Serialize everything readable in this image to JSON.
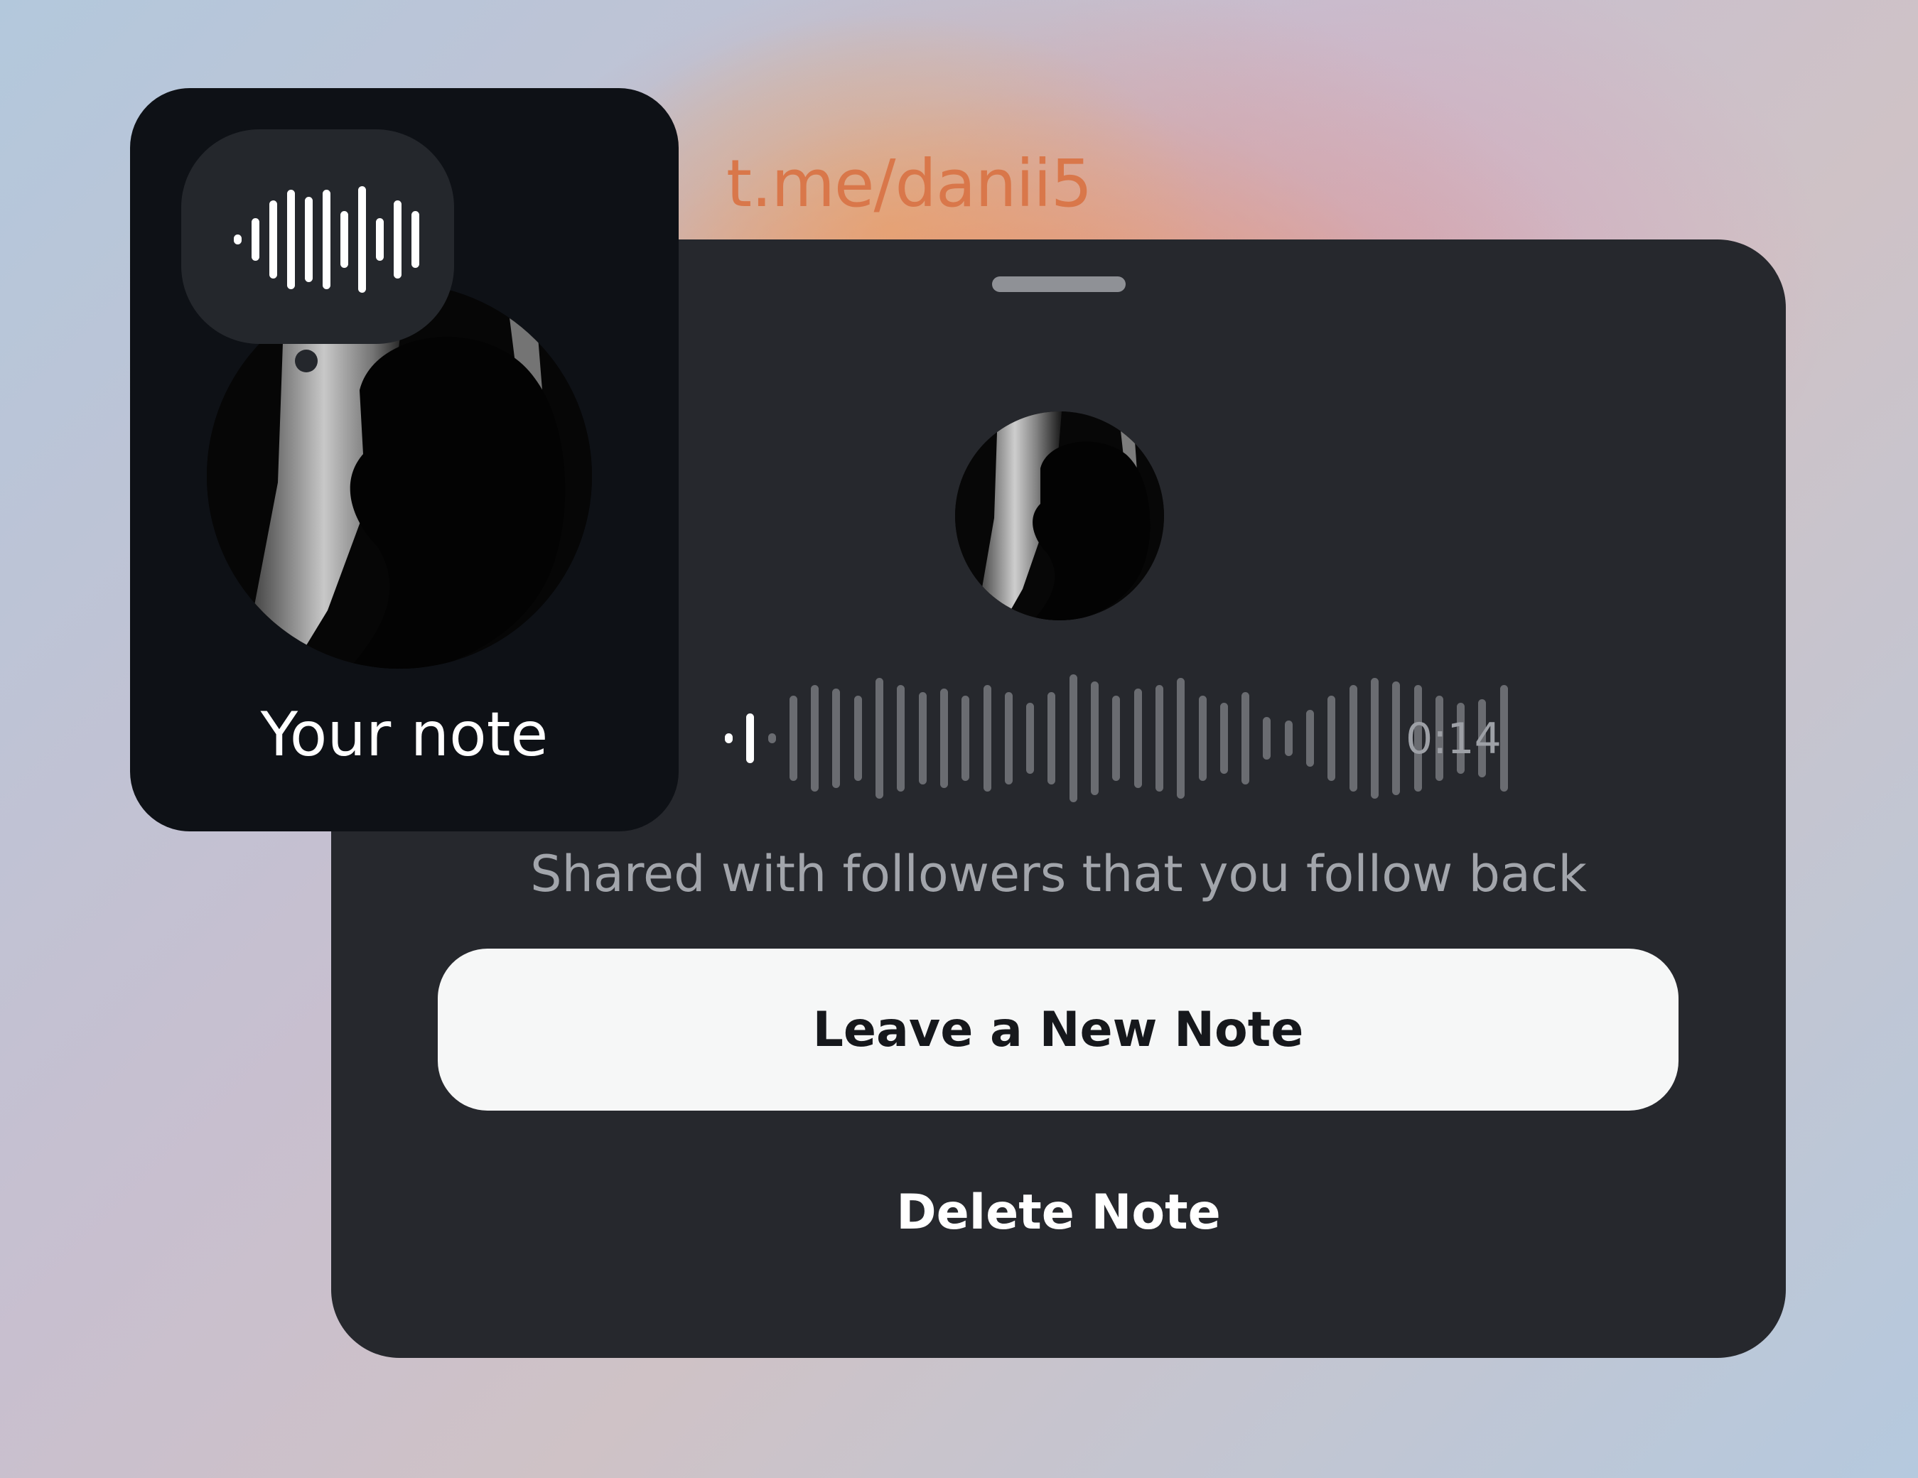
{
  "watermark": {
    "text": "t.me/danii5"
  },
  "note_card": {
    "label": "Your note",
    "bubble_icon": "audio-waveform-icon"
  },
  "sheet": {
    "duration": "0:14",
    "shared_text": "Shared with followers that you follow back",
    "primary_button": "Leave a New Note",
    "delete_button": "Delete Note",
    "playback_progress": 0.04
  },
  "colors": {
    "sheet_background": "#26282d",
    "card_background": "#0e1116",
    "button_background": "#f6f7f7",
    "waveform_unplayed": "#6a6c71",
    "waveform_played": "#ffffff",
    "watermark": "#d9774a"
  }
}
